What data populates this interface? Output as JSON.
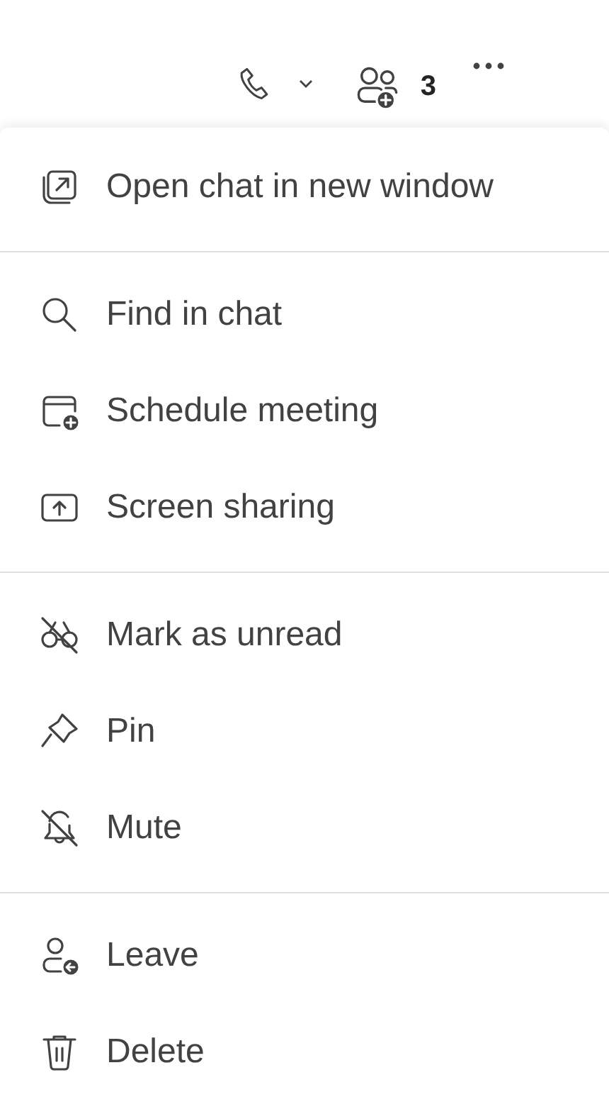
{
  "header": {
    "participant_count": "3"
  },
  "menu": {
    "groups": [
      {
        "items": [
          {
            "label": "Open chat in new window"
          }
        ]
      },
      {
        "items": [
          {
            "label": "Find in chat"
          },
          {
            "label": "Schedule meeting"
          },
          {
            "label": "Screen sharing"
          }
        ]
      },
      {
        "items": [
          {
            "label": "Mark as unread"
          },
          {
            "label": "Pin"
          },
          {
            "label": "Mute"
          }
        ]
      },
      {
        "items": [
          {
            "label": "Leave"
          },
          {
            "label": "Delete"
          }
        ]
      }
    ]
  }
}
